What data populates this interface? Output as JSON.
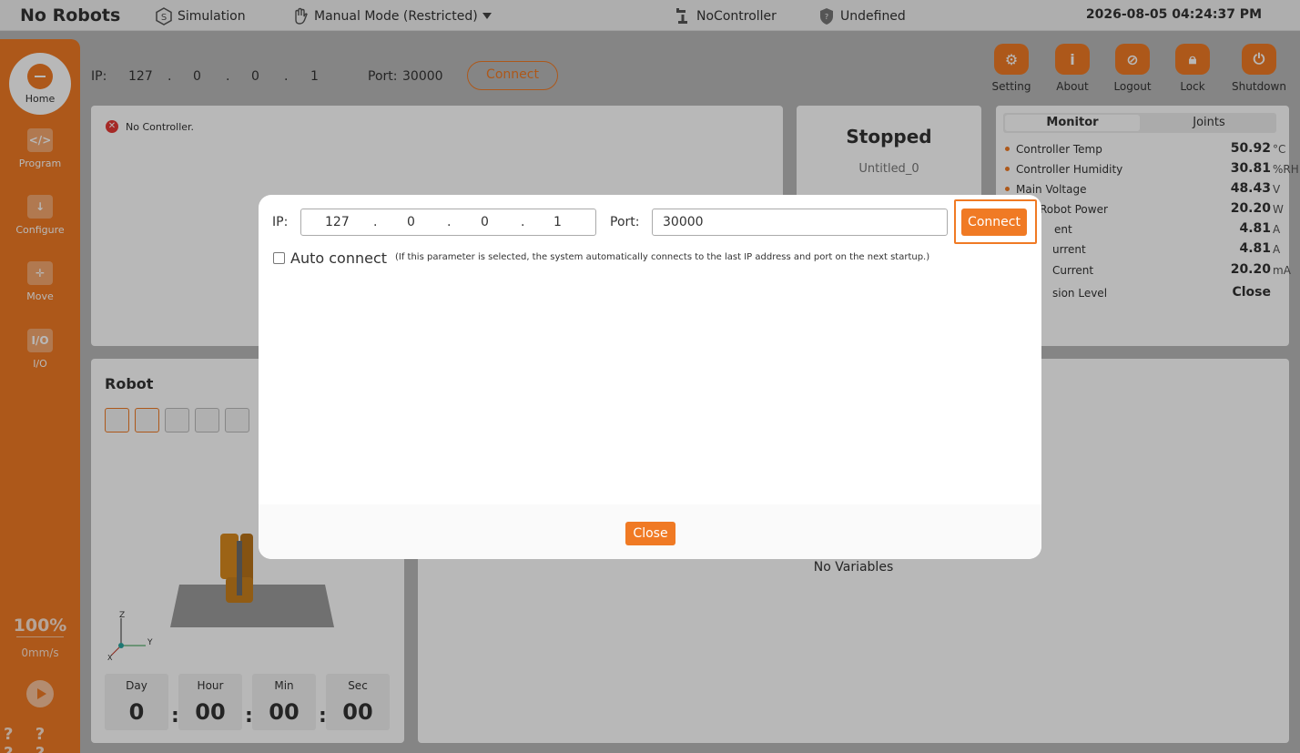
{
  "topbar": {
    "title": "No Robots",
    "simulation": "Simulation",
    "mode": "Manual Mode (Restricted)",
    "controller": "NoController",
    "safety": "Undefined",
    "datetime": "2026-08-05 04:24:37 PM"
  },
  "sidebar": {
    "items": [
      {
        "label": "Home",
        "icon": "home-icon"
      },
      {
        "label": "Program",
        "icon": "code-icon"
      },
      {
        "label": "Configure",
        "icon": "download-icon"
      },
      {
        "label": "Move",
        "icon": "move-icon"
      },
      {
        "label": "I/O",
        "icon": "io-icon"
      }
    ],
    "speed_percent": "100%",
    "speed_mm": "0mm/s",
    "help": "? ? ? ?"
  },
  "connection": {
    "ip_label": "IP:",
    "ip": [
      "127",
      "0",
      "0",
      "1"
    ],
    "port_label": "Port:",
    "port": "30000",
    "connect_label": "Connect"
  },
  "toolbar": [
    {
      "label": "Setting",
      "icon": "gear-icon"
    },
    {
      "label": "About",
      "icon": "info-icon"
    },
    {
      "label": "Logout",
      "icon": "logout-icon"
    },
    {
      "label": "Lock",
      "icon": "lock-icon"
    },
    {
      "label": "Shutdown",
      "icon": "power-icon"
    }
  ],
  "status": {
    "message": "No Controller.",
    "program_state": "Stopped",
    "program_name": "Untitled_0"
  },
  "monitor": {
    "tabs": [
      "Monitor",
      "Joints"
    ],
    "rows": [
      {
        "label": "Controller Temp",
        "value": "50.92",
        "unit": "°C"
      },
      {
        "label": "Controller Humidity",
        "value": "30.81",
        "unit": "%RH"
      },
      {
        "label": "Main Voltage",
        "value": "48.43",
        "unit": "V"
      },
      {
        "label": "Robot Power",
        "value": "20.20",
        "unit": "W"
      },
      {
        "label": "ent",
        "value": "4.81",
        "unit": "A"
      },
      {
        "label": "urrent",
        "value": "4.81",
        "unit": "A"
      },
      {
        "label": "Current",
        "value": "20.20",
        "unit": "mA"
      },
      {
        "label": "sion Level",
        "value": "Close",
        "unit": ""
      }
    ]
  },
  "robot": {
    "title": "Robot",
    "timer": [
      {
        "label": "Day",
        "value": "0"
      },
      {
        "label": "Hour",
        "value": "00"
      },
      {
        "label": "Min",
        "value": "00"
      },
      {
        "label": "Sec",
        "value": "00"
      }
    ],
    "axes": {
      "z": "Z",
      "y": "Y",
      "x": "X"
    }
  },
  "variables": {
    "empty_text": "No Variables"
  },
  "modal": {
    "ip_label": "IP:",
    "ip": [
      "127",
      "0",
      "0",
      "1"
    ],
    "port_label": "Port:",
    "port": "30000",
    "connect_label": "Connect",
    "auto_connect_label": "Auto connect",
    "auto_connect_checked": false,
    "auto_connect_note": "(If this parameter is selected, the system automatically connects to the last IP address and port on the next startup.)",
    "close_label": "Close"
  },
  "colors": {
    "accent": "#f07a24",
    "error": "#e53935"
  }
}
